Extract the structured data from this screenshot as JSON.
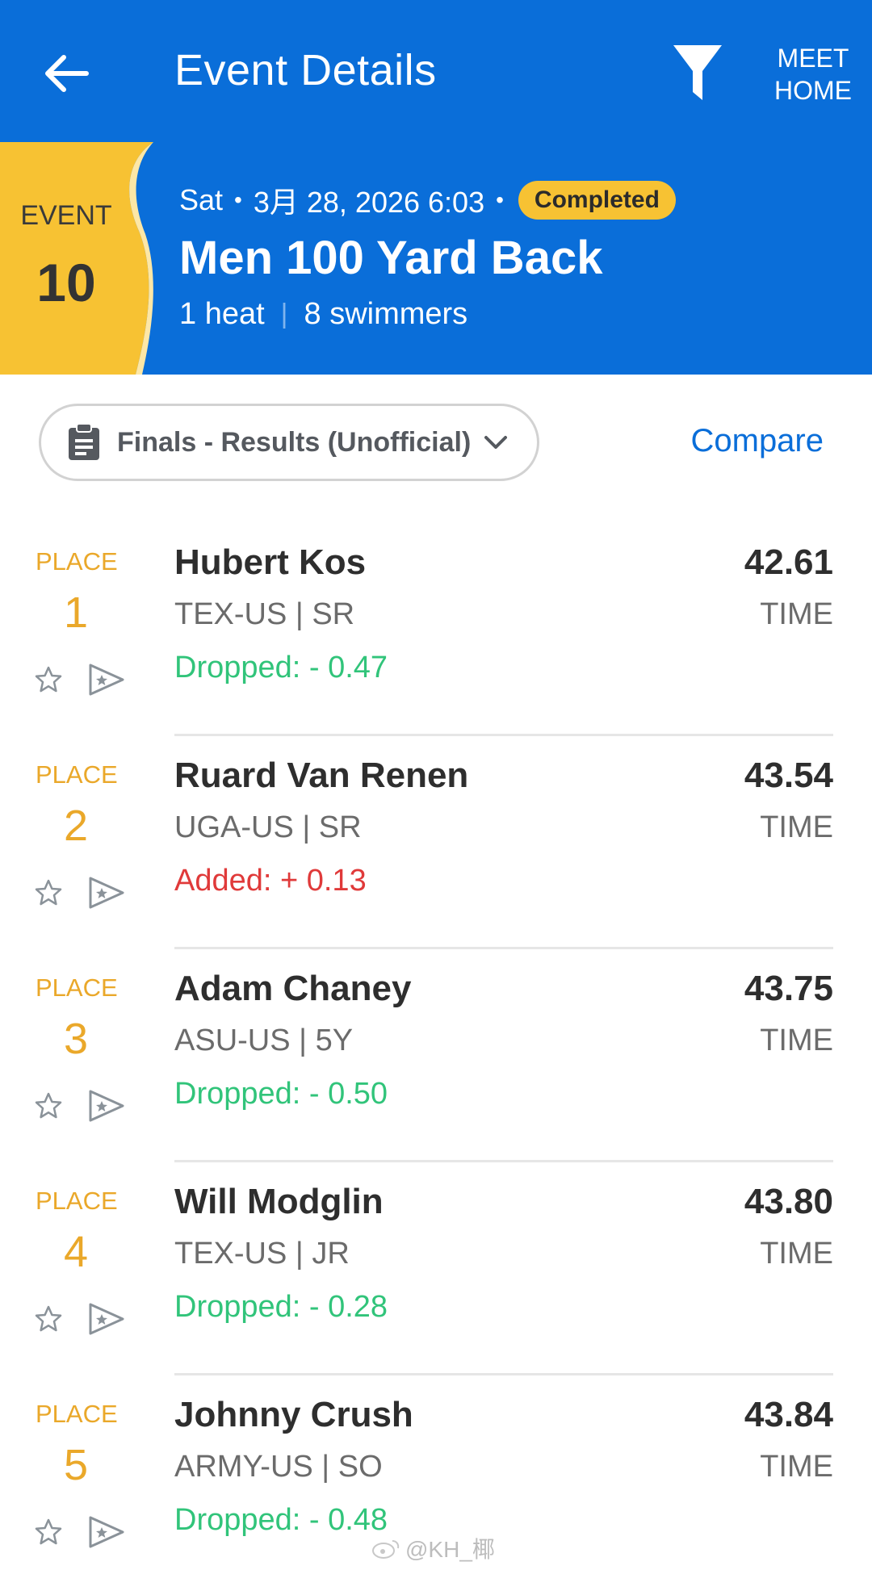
{
  "appbar": {
    "title": "Event Details",
    "meet_home_line1": "MEET",
    "meet_home_line2": "HOME"
  },
  "event": {
    "label": "EVENT",
    "number": "10",
    "day": "Sat",
    "datetime": "3月 28, 2026 6:03",
    "status": "Completed",
    "name": "Men 100 Yard Back",
    "heats": "1 heat",
    "swimmers": "8 swimmers"
  },
  "selector": {
    "label": "Finals - Results (Unofficial)",
    "compare": "Compare"
  },
  "results": [
    {
      "place_label": "PLACE",
      "place": "1",
      "name": "Hubert Kos",
      "team": "TEX-US | SR",
      "delta": "Dropped: - 0.47",
      "delta_type": "drop",
      "time": "42.61",
      "time_label": "TIME"
    },
    {
      "place_label": "PLACE",
      "place": "2",
      "name": "Ruard Van Renen",
      "team": "UGA-US | SR",
      "delta": "Added: + 0.13",
      "delta_type": "add",
      "time": "43.54",
      "time_label": "TIME"
    },
    {
      "place_label": "PLACE",
      "place": "3",
      "name": "Adam Chaney",
      "team": "ASU-US | 5Y",
      "delta": "Dropped: - 0.50",
      "delta_type": "drop",
      "time": "43.75",
      "time_label": "TIME"
    },
    {
      "place_label": "PLACE",
      "place": "4",
      "name": "Will Modglin",
      "team": "TEX-US | JR",
      "delta": "Dropped: - 0.28",
      "delta_type": "drop",
      "time": "43.80",
      "time_label": "TIME"
    },
    {
      "place_label": "PLACE",
      "place": "5",
      "name": "Johnny Crush",
      "team": "ARMY-US | SO",
      "delta": "Dropped: - 0.48",
      "delta_type": "drop",
      "time": "43.84",
      "time_label": "TIME"
    }
  ],
  "watermark": "@KH_椰",
  "colors": {
    "primary_blue": "#0a6ed9",
    "accent_yellow": "#f7c233",
    "place_gold": "#eaa82a",
    "dropped_green": "#31c47a",
    "added_red": "#e03a3a"
  },
  "icons": {
    "back": "arrow-left-icon",
    "filter": "funnel-icon",
    "selector": "clipboard-icon",
    "dropdown": "chevron-down-icon",
    "favorite": "star-outline-icon",
    "flag": "pennant-star-icon"
  }
}
